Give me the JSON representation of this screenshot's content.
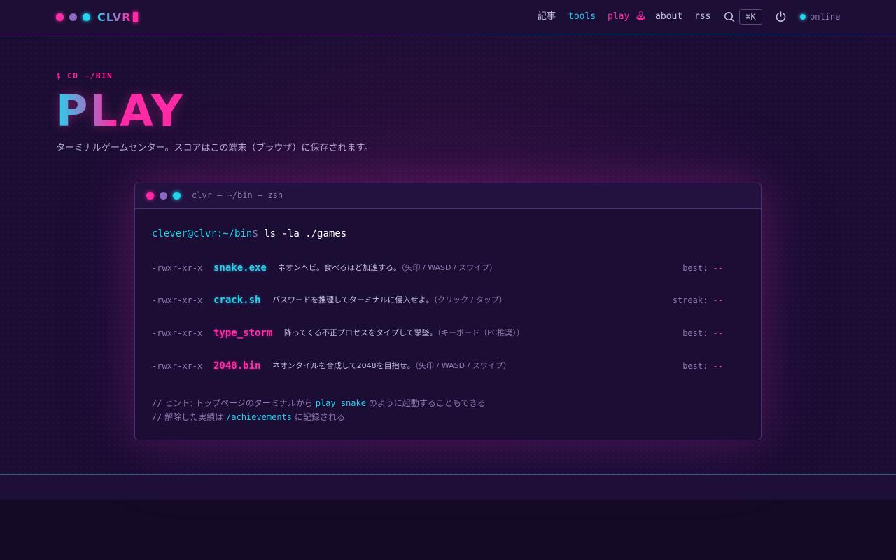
{
  "header": {
    "logo_text": "CLVR",
    "nav": [
      {
        "label": "記事"
      },
      {
        "label": "tools"
      },
      {
        "label": "play 🕹"
      },
      {
        "label": "about"
      },
      {
        "label": "rss"
      }
    ],
    "search_shortcut": "⌘K",
    "status_label": "online"
  },
  "hero": {
    "prompt": "$ CD ~/BIN",
    "title": "PLAY",
    "subtitle": "ターミナルゲームセンター。スコアはこの端末（ブラウザ）に保存されます。"
  },
  "terminal": {
    "window_title": "clvr — ~/bin — zsh",
    "prompt_user": "clever@clvr",
    "prompt_path": ":~/bin",
    "prompt_symbol": "$",
    "command": "ls -la ./games",
    "games": [
      {
        "perm": "-rwxr-xr-x",
        "name": "snake.exe",
        "color": "#22d3ee",
        "desc": "ネオンヘビ。食べるほど加速する。",
        "controls": "（矢印 / WASD / スワイプ）",
        "score_label": "best:",
        "score": "--"
      },
      {
        "perm": "-rwxr-xr-x",
        "name": "crack.sh",
        "color": "#22d3ee",
        "desc": "パスワードを推理してターミナルに侵入せよ。",
        "controls": "（クリック / タップ）",
        "score_label": "streak:",
        "score": "--"
      },
      {
        "perm": "-rwxr-xr-x",
        "name": "type_storm",
        "color": "#ff2ba6",
        "desc": "降ってくる不正プロセスをタイプして撃墜。",
        "controls": "（キーボード（PC推奨））",
        "score_label": "best:",
        "score": "--"
      },
      {
        "perm": "-rwxr-xr-x",
        "name": "2048.bin",
        "color": "#ff2ba6",
        "desc": "ネオンタイルを合成して2048を目指せ。",
        "controls": "（矢印 / WASD / スワイプ）",
        "score_label": "best:",
        "score": "--"
      }
    ],
    "hints": [
      {
        "slashes": "//",
        "before": " ヒント: トップページのターミナルから ",
        "highlight": "play snake",
        "after": " のように起動することもできる"
      },
      {
        "slashes": "//",
        "before": " 解除した実績は ",
        "highlight": "/achievements",
        "after": " に記録される"
      }
    ]
  },
  "colors": {
    "accent_pink": "#ff2ba6",
    "accent_cyan": "#22d3ee",
    "background": "#150a26"
  }
}
